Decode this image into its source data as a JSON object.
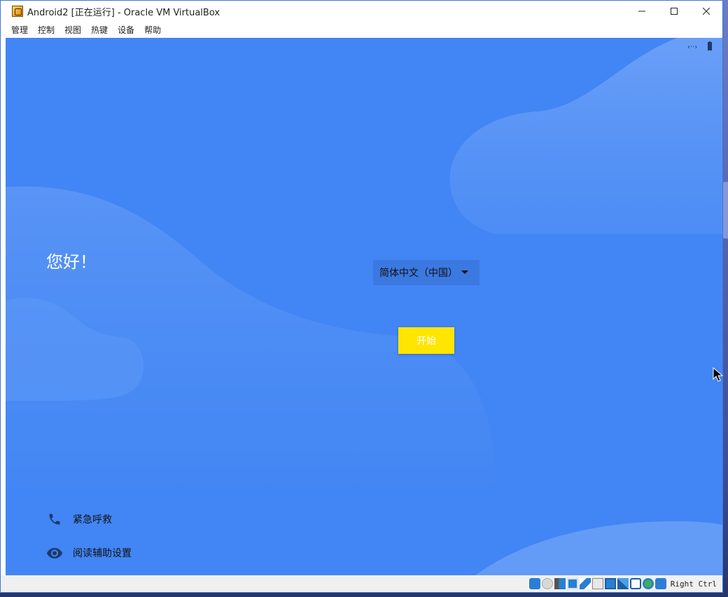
{
  "window": {
    "title": "Android2 [正在运行] - Oracle VM VirtualBox",
    "controls": {
      "minimize": "—",
      "maximize": "☐",
      "close": "✕"
    }
  },
  "menu": [
    "管理",
    "控制",
    "视图",
    "热键",
    "设备",
    "帮助"
  ],
  "android": {
    "greeting": "您好！",
    "language": "简体中文（中国）",
    "start_button": "开始",
    "emergency_call": "紧急呼救",
    "accessibility": "阅读辅助设置",
    "colors": {
      "background": "#4285f4",
      "start_button": "#ffe500"
    }
  },
  "statusbar": {
    "host_key": "Right Ctrl",
    "icons": [
      "hard-disk-icon",
      "optical-drive-icon",
      "audio-icon",
      "network-icon",
      "usb-icon",
      "shared-folders-icon",
      "display-icon",
      "recording-icon",
      "virtualization-icon",
      "mouse-integration-icon",
      "keyboard-capture-icon"
    ]
  }
}
